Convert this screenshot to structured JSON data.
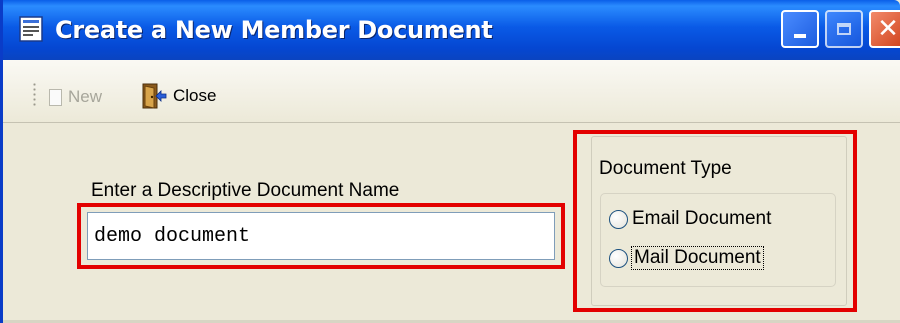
{
  "window": {
    "title": "Create a New Member Document",
    "controls": {
      "minimize": "minimize",
      "maximize": "maximize",
      "close": "close"
    }
  },
  "toolbar": {
    "new_label": "New",
    "new_enabled": false,
    "close_label": "Close"
  },
  "form": {
    "name_label": "Enter a Descriptive Document Name",
    "name_value": "demo document"
  },
  "document_type": {
    "legend": "Document Type",
    "options": [
      {
        "label": "Email Document",
        "selected": false
      },
      {
        "label": "Mail Document",
        "selected": false,
        "focused": true
      }
    ]
  },
  "colors": {
    "titlebar": "#0a5ae6",
    "window_bg": "#ece9d8",
    "highlight": "#e30000",
    "close_button": "#d0421c"
  },
  "icons": {
    "title": "form-icon",
    "new": "new-document-icon",
    "close": "exit-door-icon",
    "minimize": "minimize-icon",
    "maximize": "maximize-icon",
    "close_window": "close-icon"
  }
}
